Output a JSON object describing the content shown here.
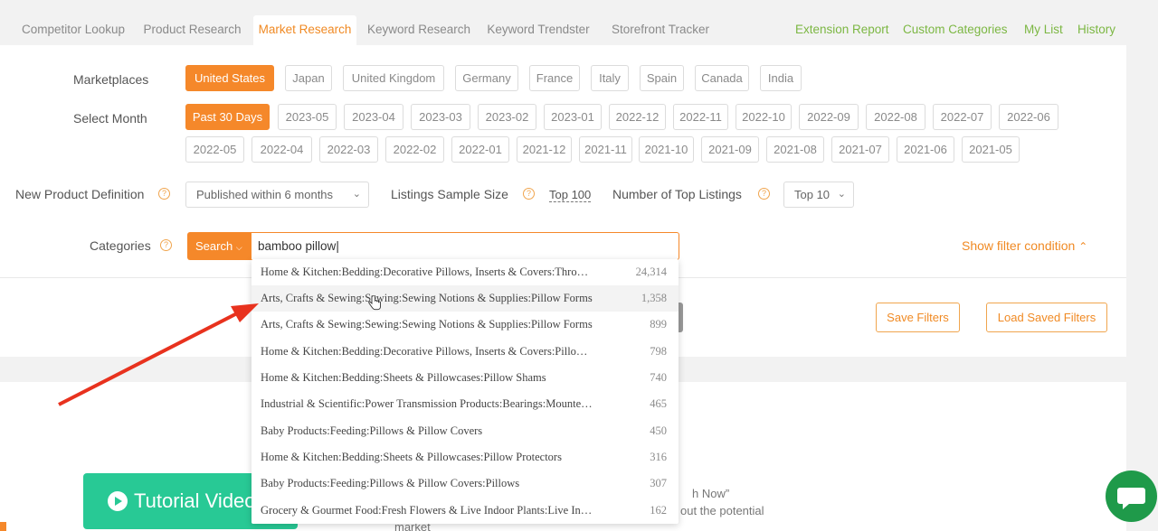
{
  "tabs": [
    {
      "label": "Competitor Lookup",
      "active": false
    },
    {
      "label": "Product Research",
      "active": false
    },
    {
      "label": "Market Research",
      "active": true
    },
    {
      "label": "Keyword Research",
      "active": false
    },
    {
      "label": "Keyword Trendster",
      "active": false
    },
    {
      "label": "Storefront Tracker",
      "active": false
    }
  ],
  "right_links": [
    "Extension Report",
    "Custom Categories",
    "My List",
    "History"
  ],
  "marketplaces": {
    "label": "Marketplaces",
    "selected": "United States",
    "options": [
      "United States",
      "Japan",
      "United Kingdom",
      "Germany",
      "France",
      "Italy",
      "Spain",
      "Canada",
      "India"
    ]
  },
  "month": {
    "label": "Select Month",
    "selected": "Past 30 Days",
    "row1": [
      "Past 30 Days",
      "2023-05",
      "2023-04",
      "2023-03",
      "2023-02",
      "2023-01",
      "2022-12",
      "2022-11",
      "2022-10",
      "2022-09",
      "2022-08",
      "2022-07",
      "2022-06"
    ],
    "row2": [
      "2022-05",
      "2022-04",
      "2022-03",
      "2022-02",
      "2022-01",
      "2021-12",
      "2021-11",
      "2021-10",
      "2021-09",
      "2021-08",
      "2021-07",
      "2021-06",
      "2021-05"
    ]
  },
  "new_product": {
    "label": "New Product Definition",
    "value": "Published within 6 months"
  },
  "sample_size": {
    "label": "Listings Sample Size",
    "value": "Top 100"
  },
  "top_listings": {
    "label": "Number of Top Listings",
    "value": "Top 10"
  },
  "categories": {
    "label": "Categories",
    "search_label": "Search",
    "query": "bamboo pillow",
    "show_filter": "Show filter condition"
  },
  "buttons": {
    "save": "Save Filters",
    "load": "Load Saved Filters"
  },
  "suggestions": [
    {
      "text": "Home & Kitchen:Bedding:Decorative Pillows, Inserts & Covers:Throw Pillows",
      "count": "24,314"
    },
    {
      "text": "Arts, Crafts & Sewing:Sewing:Sewing Notions & Supplies:Pillow Forms",
      "count": "1,358"
    },
    {
      "text": "Arts, Crafts & Sewing:Sewing:Sewing Notions & Supplies:Pillow Forms",
      "count": "899"
    },
    {
      "text": "Home & Kitchen:Bedding:Decorative Pillows, Inserts & Covers:Pillow Inserts",
      "count": "798"
    },
    {
      "text": "Home & Kitchen:Bedding:Sheets & Pillowcases:Pillow Shams",
      "count": "740"
    },
    {
      "text": "Industrial & Scientific:Power Transmission Products:Bearings:Mounted Bearings",
      "count": "465"
    },
    {
      "text": "Baby Products:Feeding:Pillows & Pillow Covers",
      "count": "450"
    },
    {
      "text": "Home & Kitchen:Bedding:Sheets & Pillowcases:Pillow Protectors",
      "count": "316"
    },
    {
      "text": "Baby Products:Feeding:Pillows & Pillow Covers:Pillows",
      "count": "307"
    },
    {
      "text": "Grocery & Gourmet Food:Fresh Flowers & Live Indoor Plants:Live Indoor Plants",
      "count": "162"
    }
  ],
  "lower": {
    "tutorial": "Tutorial Video",
    "text1": "h Now”",
    "text2": "out the potential",
    "text3": "market"
  },
  "colors": {
    "accent": "#f5882a",
    "link_green": "#7cb743",
    "tutorial_green": "#28c995",
    "arrow_red": "#e8321e"
  }
}
